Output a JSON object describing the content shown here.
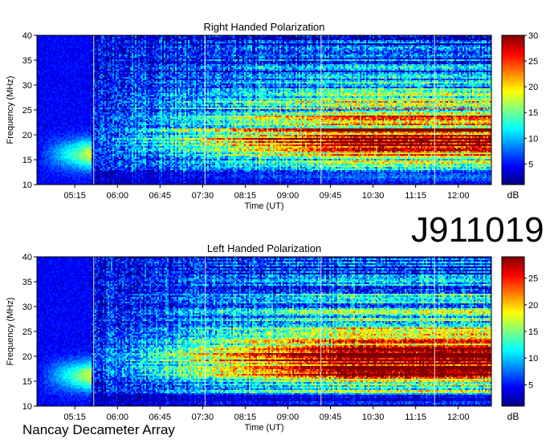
{
  "observation_id": "J911019",
  "instrument": "Nancay Decameter Array",
  "chart_data": [
    {
      "type": "heatmap",
      "title": "Right Handed Polarization",
      "xlabel": "Time (UT)",
      "ylabel": "Frequency (MHz)",
      "x_ticks": [
        "05:15",
        "06:00",
        "06:45",
        "07:30",
        "08:15",
        "09:00",
        "09:45",
        "10:30",
        "11:15",
        "12:00"
      ],
      "x_range": [
        "04:35",
        "12:35"
      ],
      "y_ticks": [
        10,
        15,
        20,
        25,
        30,
        35,
        40
      ],
      "ylim": [
        10,
        40
      ],
      "colorbar": {
        "label": "dB",
        "ticks": [
          5,
          10,
          15,
          20,
          25,
          30
        ],
        "range": [
          1,
          30
        ]
      },
      "colormap": [
        "#00007f",
        "#0000ff",
        "#007fff",
        "#00ffff",
        "#7fff7f",
        "#ffff00",
        "#ff7f00",
        "#ff0000",
        "#7f0000"
      ]
    },
    {
      "type": "heatmap",
      "title": "Left Handed Polarization",
      "xlabel": "Time (UT)",
      "ylabel": "Frequency (MHz)",
      "x_ticks": [
        "05:15",
        "06:00",
        "06:45",
        "07:30",
        "08:15",
        "09:00",
        "09:45",
        "10:30",
        "11:15",
        "12:00"
      ],
      "x_range": [
        "04:35",
        "12:35"
      ],
      "y_ticks": [
        10,
        15,
        20,
        25,
        30,
        35,
        40
      ],
      "ylim": [
        10,
        40
      ],
      "colorbar": {
        "label": "dB",
        "ticks": [
          5,
          10,
          15,
          20,
          25
        ],
        "range": [
          1,
          29
        ]
      },
      "colormap": [
        "#00007f",
        "#0000ff",
        "#007fff",
        "#00ffff",
        "#7fff7f",
        "#ffff00",
        "#ff7f00",
        "#ff0000",
        "#7f0000"
      ]
    }
  ]
}
